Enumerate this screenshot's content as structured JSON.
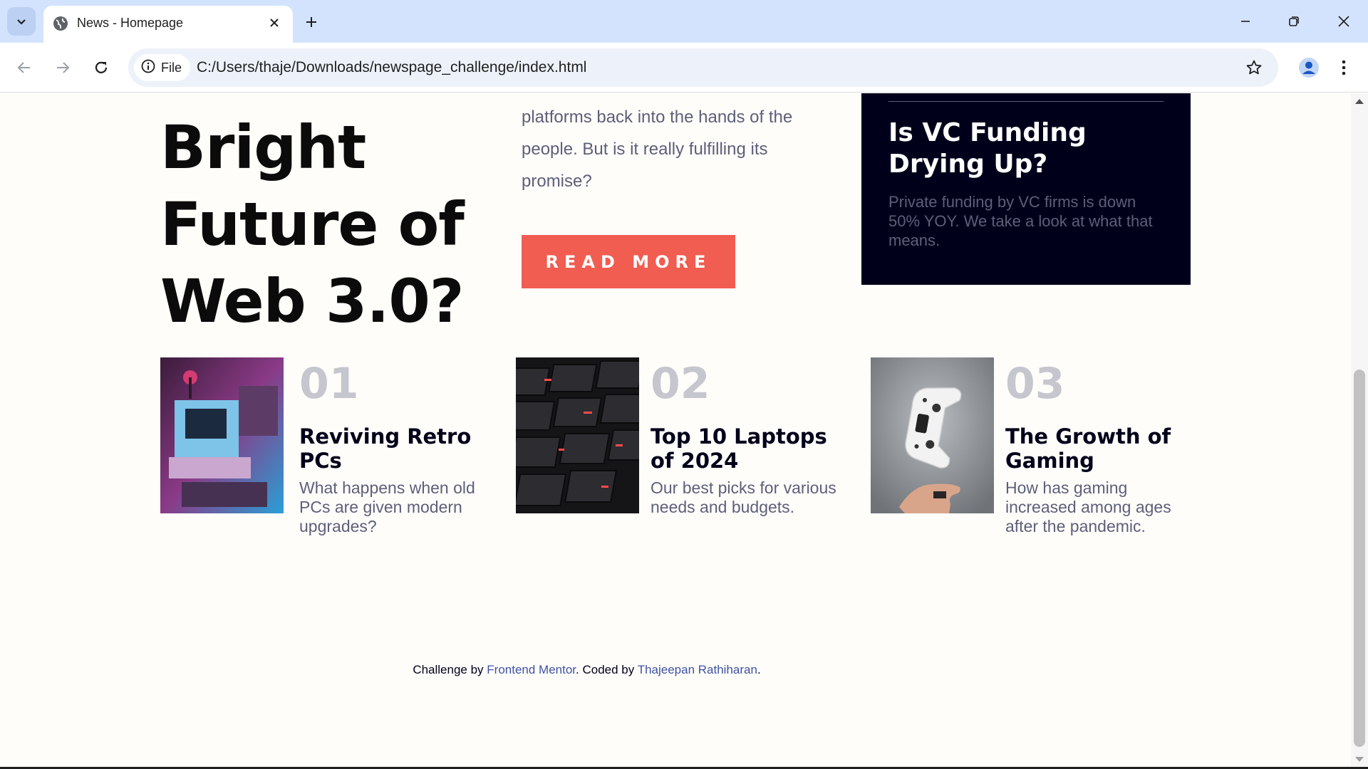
{
  "browser": {
    "tab_title": "News - Homepage",
    "chip_label": "File",
    "url": "C:/Users/thaje/Downloads/newspage_challenge/index.html"
  },
  "hero": {
    "headline_lines": [
      "Bright",
      "Future of",
      "Web 3.0?"
    ],
    "intro_line_1": "platforms back into the hands of the",
    "intro_line_2": "people. But is it really fulfilling its",
    "intro_line_3": "promise?",
    "read_more_label": "READ MORE"
  },
  "new_panel": {
    "title": "Is VC Funding Drying Up?",
    "description": "Private funding by VC firms is down 50% YOY. We take a look at what that means."
  },
  "cards": [
    {
      "number": "01",
      "title": "Reviving Retro PCs",
      "description": "What happens when old PCs are given modern upgrades?"
    },
    {
      "number": "02",
      "title": "Top 10 Laptops of 2024",
      "description": "Our best picks for various needs and budgets."
    },
    {
      "number": "03",
      "title": "The Growth of Gaming",
      "description": "How has gaming increased among ages after the pandemic."
    }
  ],
  "attribution": {
    "prefix": "Challenge by",
    "link1": "Frontend Mentor",
    "middle": ". Coded by",
    "link2": "Thajeepan Rathiharan",
    "suffix": "."
  },
  "colors": {
    "accent": "#f15d51",
    "dark": "#00001a",
    "muted": "#5d5f79",
    "number": "#c5c6ce",
    "link": "#3e52a3",
    "tabbar": "#d3e3fd"
  },
  "icons": [
    "tab-search-icon",
    "globe-icon",
    "close-icon",
    "plus-icon",
    "minimize-icon",
    "restore-icon",
    "window-close-icon",
    "back-icon",
    "forward-icon",
    "reload-icon",
    "info-icon",
    "star-icon",
    "profile-icon",
    "more-vert-icon"
  ]
}
